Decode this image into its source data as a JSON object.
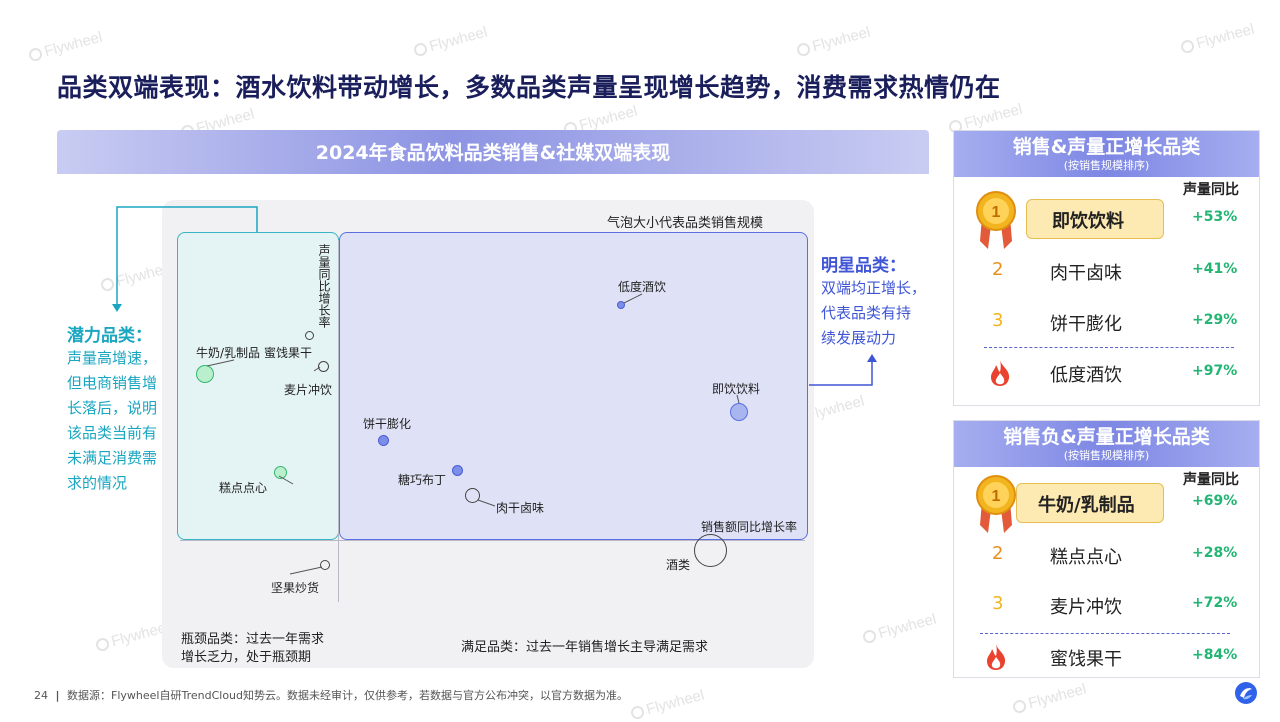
{
  "page": {
    "title": "品类双端表现：酒水饮料带动增长，多数品类声量呈现增长趋势，消费需求热情仍在",
    "watermark": "Flywheel",
    "page_number": "24",
    "footer": "数据源：Flywheel自研TrendCloud知势云。数据未经审计，仅供参考，若数据与官方公布冲突，以官方数据为准。"
  },
  "chart": {
    "banner": "2024年食品饮料品类销售&社媒双端表现",
    "bubble_note": "气泡大小代表品类销售规模",
    "y_axis_label": "声量同比增长率",
    "x_axis_label": "销售额同比增长率",
    "potential": {
      "title": "潜力品类：",
      "lines": [
        "声量高增速，",
        "但电商销售增",
        "长落后，说明",
        "该品类当前有",
        "未满足消费需",
        "求的情况"
      ]
    },
    "star": {
      "title": "明星品类：",
      "lines": [
        "双端均正增长，",
        "代表品类有持",
        "续发展动力"
      ]
    },
    "bottleneck": [
      "瓶颈品类：过去一年需求",
      "增长乏力，处于瓶颈期"
    ],
    "satisfy": "满足品类：过去一年销售增长主导满足需求"
  },
  "chart_data": {
    "type": "scatter",
    "title": "2024年食品饮料品类销售&社媒双端表现",
    "xlabel": "销售额同比增长率",
    "ylabel": "声量同比增长率",
    "points": [
      {
        "name": "低度酒饮",
        "quadrant": "star"
      },
      {
        "name": "即饮饮料",
        "quadrant": "star"
      },
      {
        "name": "饼干膨化",
        "quadrant": "star"
      },
      {
        "name": "糖巧布丁",
        "quadrant": "star"
      },
      {
        "name": "肉干卤味",
        "quadrant": "star"
      },
      {
        "name": "牛奶/乳制品",
        "quadrant": "potential"
      },
      {
        "name": "蜜饯果干",
        "quadrant": "potential"
      },
      {
        "name": "麦片冲饮",
        "quadrant": "potential"
      },
      {
        "name": "糕点点心",
        "quadrant": "potential"
      },
      {
        "name": "坚果炒货",
        "quadrant": "bottleneck"
      },
      {
        "name": "酒类",
        "quadrant": "satisfy"
      }
    ]
  },
  "panel_positive": {
    "title": "销售&声量正增长品类",
    "subtitle": "(按销售规模排序)",
    "col_header": "声量同比",
    "rows": [
      {
        "rank": "1",
        "name": "即饮饮料",
        "value": "+53%"
      },
      {
        "rank": "2",
        "name": "肉干卤味",
        "value": "+41%"
      },
      {
        "rank": "3",
        "name": "饼干膨化",
        "value": "+29%"
      },
      {
        "rank": "fire",
        "name": "低度酒饮",
        "value": "+97%"
      }
    ]
  },
  "panel_negative": {
    "title": "销售负&声量正增长品类",
    "subtitle": "(按销售规模排序)",
    "col_header": "声量同比",
    "rows": [
      {
        "rank": "1",
        "name": "牛奶/乳制品",
        "value": "+69%"
      },
      {
        "rank": "2",
        "name": "糕点点心",
        "value": "+28%"
      },
      {
        "rank": "3",
        "name": "麦片冲饮",
        "value": "+72%"
      },
      {
        "rank": "fire",
        "name": "蜜饯果干",
        "value": "+84%"
      }
    ]
  },
  "colors": {
    "title": "#1a1f5c",
    "teal": "#19a6c0",
    "blue": "#3f55d6",
    "green": "#22b573",
    "gold": "#f2b51f",
    "orange": "#e8901e"
  }
}
